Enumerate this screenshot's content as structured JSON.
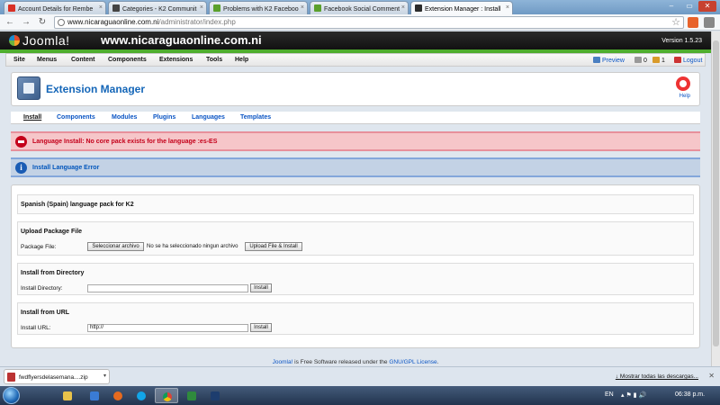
{
  "browser": {
    "tabs": [
      {
        "title": "Account Details for Rembe",
        "color": "#d93025"
      },
      {
        "title": "Categories - K2 Communit",
        "color": "#444444"
      },
      {
        "title": "Problems with K2 Faceboo",
        "color": "#5aa02c"
      },
      {
        "title": "Facebook Social Comment",
        "color": "#5aa02c"
      },
      {
        "title": "Extension Manager : Install",
        "color": "#2b2b2b"
      }
    ],
    "url_host": "www.nicaraguaonline.com.ni",
    "url_path": "/administrator/index.php"
  },
  "joomla": {
    "logo_text": "Joomla!",
    "site_name": "www.nicaraguaonline.com.ni",
    "version": "Version 1.5.23",
    "menu": [
      "Site",
      "Menus",
      "Content",
      "Components",
      "Extensions",
      "Tools",
      "Help"
    ],
    "status": {
      "preview": "Preview",
      "messages": "0",
      "users": "1",
      "logout": "Logout"
    },
    "toolbar_title": "Extension Manager",
    "help_label": "Help",
    "submenu": [
      "Install",
      "Components",
      "Modules",
      "Plugins",
      "Languages",
      "Templates"
    ],
    "error_message": "Language Install: No core pack exists for the language :es-ES",
    "info_message": "Install Language Error",
    "pack_title": "Spanish (Spain) language pack for K2",
    "upload": {
      "legend": "Upload Package File",
      "label": "Package File:",
      "choose_button": "Seleccionar archivo",
      "no_file": "No se ha seleccionado ningun archivo",
      "submit": "Upload File & Install"
    },
    "directory": {
      "legend": "Install from Directory",
      "label": "Install Directory:",
      "value": "",
      "submit": "Install"
    },
    "url_install": {
      "legend": "Install from URL",
      "label": "Install URL:",
      "value": "http://",
      "submit": "Install"
    },
    "footer": {
      "link1": "Joomla!",
      "text": " is Free Software released under the ",
      "link2": "GNU/GPL License",
      "end": "."
    }
  },
  "downloads": {
    "file_name": "fwdflyersdelasemana....zip",
    "show_all": "Mostrar todas las descargas..."
  },
  "taskbar": {
    "language": "EN",
    "time": "06:38 p.m."
  }
}
